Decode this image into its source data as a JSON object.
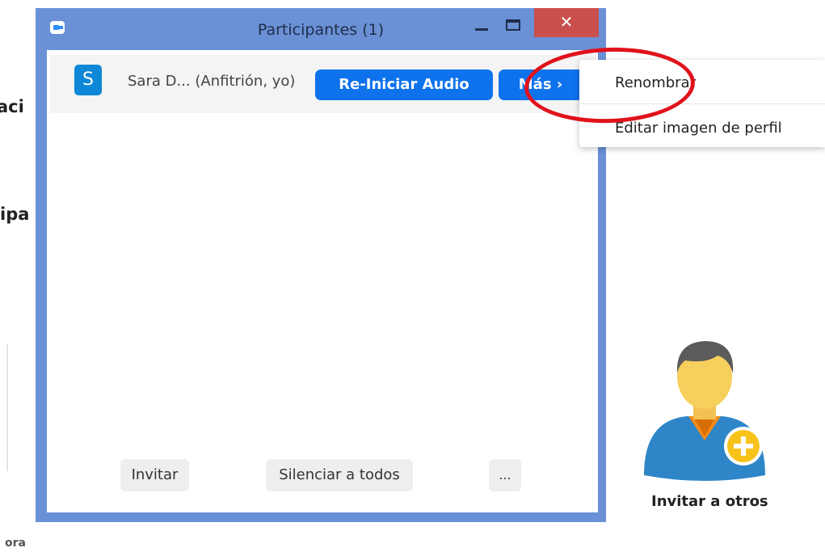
{
  "background": {
    "fragment_1": "aci",
    "fragment_2": "ipa",
    "fragment_3": "ora"
  },
  "window": {
    "title": "Participantes (1)",
    "close_label": "✕"
  },
  "participant": {
    "avatar_letter": "S",
    "name": "Sara D... (Anfitrión, yo)",
    "audio_button": "Re-Iniciar Audio",
    "more_button": "Más ›"
  },
  "footer": {
    "invite": "Invitar",
    "mute_all": "Silenciar a todos",
    "more": "..."
  },
  "context_menu": {
    "items": [
      "Renombrar",
      "Editar imagen de perfil"
    ]
  },
  "invite_others": {
    "label": "Invitar a otros"
  },
  "colors": {
    "window_frame": "#6a91d6",
    "primary_button": "#0e72ed",
    "close_button": "#c9504c",
    "annotation": "#e0121b"
  }
}
